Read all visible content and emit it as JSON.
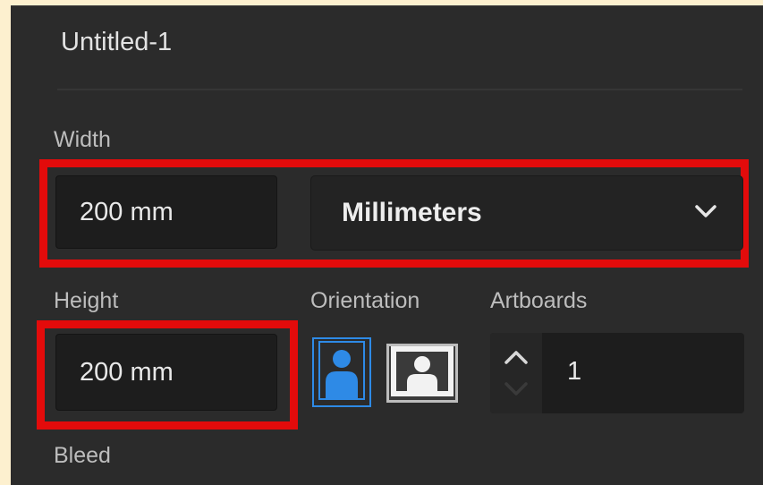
{
  "document": {
    "name": "Untitled-1"
  },
  "width": {
    "label": "Width",
    "value": "200 mm",
    "unit": "Millimeters"
  },
  "height": {
    "label": "Height",
    "value": "200 mm"
  },
  "orientation": {
    "label": "Orientation",
    "options": [
      "portrait",
      "landscape"
    ],
    "selected": "portrait"
  },
  "artboards": {
    "label": "Artboards",
    "value": "1"
  },
  "bleed": {
    "label": "Bleed"
  },
  "colors": {
    "highlight": "#e30b0b",
    "accent": "#2e8ae6",
    "panel": "#2b2b2b"
  },
  "icons": [
    "chevron-down-icon",
    "portrait-person-icon",
    "landscape-person-icon",
    "chevron-up-icon"
  ]
}
